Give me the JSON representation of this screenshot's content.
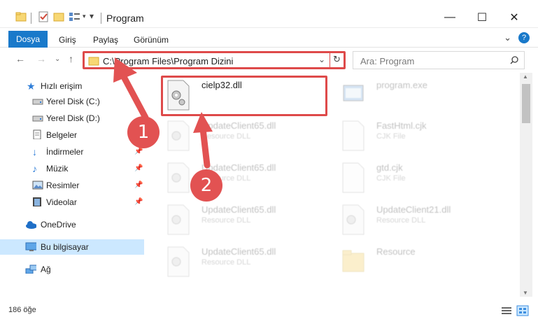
{
  "window": {
    "title": "Program",
    "controls": {
      "minimize": "—",
      "maximize": "☐",
      "close": "✕"
    }
  },
  "ribbon": {
    "tabs": [
      "Dosya",
      "Giriş",
      "Paylaş",
      "Görünüm"
    ],
    "expand_icon": "chevron-down-icon",
    "help_icon": "help-icon"
  },
  "address": {
    "path": "C:\\Program Files\\Program Dizini",
    "search_placeholder": "Ara: Program"
  },
  "nav_pane": {
    "items": [
      {
        "label": "Hızlı erişim",
        "icon": "star-icon"
      },
      {
        "label": "Yerel Disk (C:)",
        "icon": "drive-icon"
      },
      {
        "label": "Yerel Disk (D:)",
        "icon": "drive-icon"
      },
      {
        "label": "Belgeler",
        "icon": "documents-icon"
      },
      {
        "label": "İndirmeler",
        "icon": "download-icon"
      },
      {
        "label": "Müzik",
        "icon": "music-icon"
      },
      {
        "label": "Resimler",
        "icon": "pictures-icon"
      },
      {
        "label": "Videolar",
        "icon": "videos-icon"
      },
      {
        "label": "OneDrive",
        "icon": "cloud-icon"
      },
      {
        "label": "Bu bilgisayar",
        "icon": "computer-icon"
      },
      {
        "label": "Ağ",
        "icon": "network-icon"
      }
    ]
  },
  "files": [
    {
      "name": "cielp32.dll",
      "type": ""
    },
    {
      "name": "program.exe",
      "type": ""
    },
    {
      "name": "UpdateClient65.dll",
      "type": "Resource DLL"
    },
    {
      "name": "FastHtml.cjk",
      "type": "CJK File"
    },
    {
      "name": "UpdateClient65.dll",
      "type": "Resource DLL"
    },
    {
      "name": "gtd.cjk",
      "type": "CJK File"
    },
    {
      "name": "UpdateClient65.dll",
      "type": "Resource DLL"
    },
    {
      "name": "UpdateClient21.dll",
      "type": "Resource DLL"
    },
    {
      "name": "UpdateClient65.dll",
      "type": "Resource DLL"
    },
    {
      "name": "Resource",
      "type": ""
    }
  ],
  "status": {
    "item_count": "186 öğe"
  },
  "annotations": {
    "step1": "1",
    "step2": "2"
  },
  "colors": {
    "accent": "#1979ca",
    "highlight": "#de4a4a",
    "selection": "#cce8ff"
  }
}
